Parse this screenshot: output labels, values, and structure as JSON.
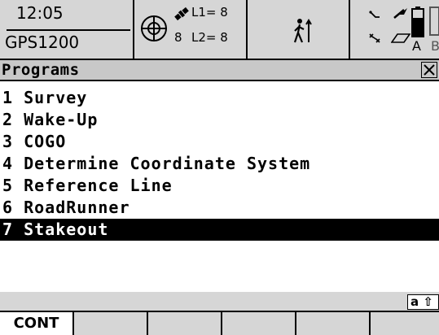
{
  "status": {
    "time": "12:05",
    "device": "GPS1200",
    "sats_count": "8",
    "l1": "L1= 8",
    "l2": "L2= 8",
    "battery_a": "A",
    "battery_b": "B",
    "icons": [
      "position-mode-icon",
      "satellite-icon",
      "walker-icon",
      "antenna-icon",
      "link-icon",
      "radio-icon",
      "memory-card-icon",
      "battery-icon"
    ]
  },
  "title_bar": {
    "title": "Programs",
    "close_label": "✕"
  },
  "programs": [
    {
      "label": "1 Survey",
      "selected": false
    },
    {
      "label": "2 Wake-Up",
      "selected": false
    },
    {
      "label": "3 COGO",
      "selected": false
    },
    {
      "label": "4 Determine Coordinate System",
      "selected": false
    },
    {
      "label": "5 Reference Line",
      "selected": false
    },
    {
      "label": "6 RoadRunner",
      "selected": false
    },
    {
      "label": "7 Stakeout",
      "selected": true
    }
  ],
  "input_mode": "a ⇧",
  "function_keys": [
    "CONT",
    "",
    "",
    "",
    "",
    ""
  ]
}
